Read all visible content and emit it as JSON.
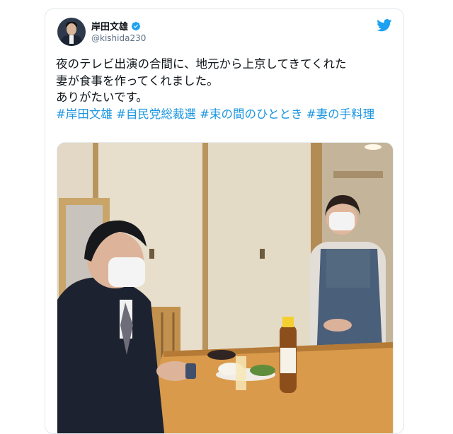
{
  "tweet": {
    "author_name": "岸田文雄",
    "author_handle": "@kishida230",
    "text_line1": "夜のテレビ出演の合間に、地元から上京してきてくれた",
    "text_line2": "妻が食事を作ってくれました。",
    "text_line3": "ありがたいです。",
    "hashtags": [
      "#岸田文雄",
      "#自民党総裁選",
      "#束の間のひととき",
      "#妻の手料理"
    ],
    "brand_icon": "twitter-bird-icon",
    "verified_icon": "verified-badge-icon",
    "link_color": "#1b95e0",
    "brand_color": "#1da1f2"
  }
}
